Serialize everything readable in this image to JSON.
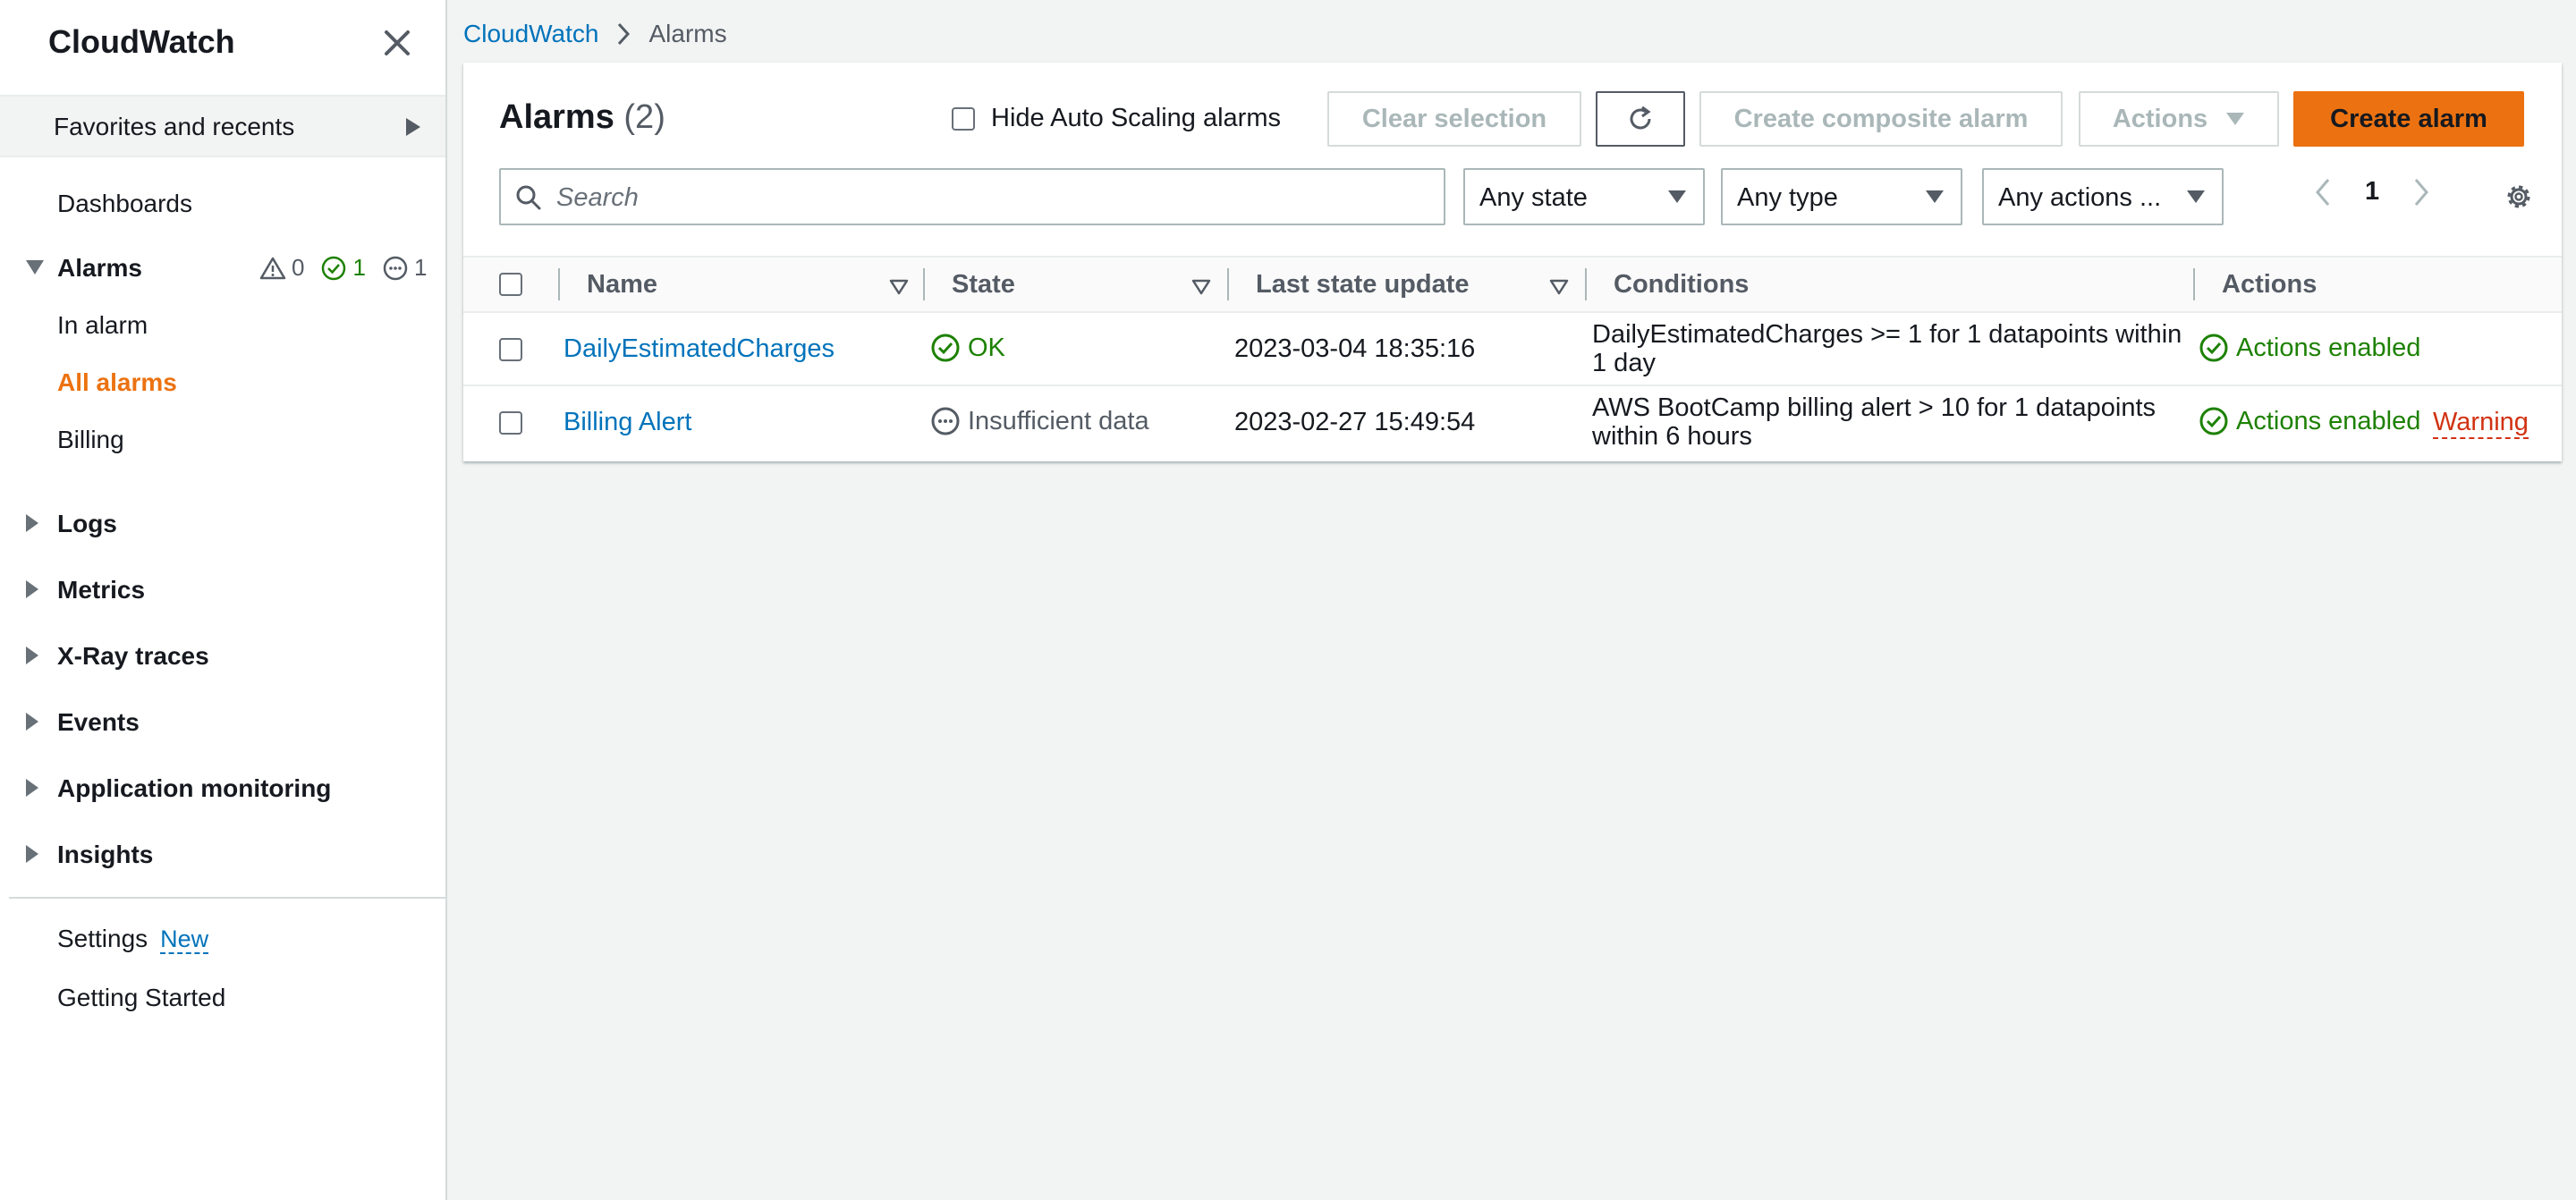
{
  "sidebar": {
    "title": "CloudWatch",
    "favorites": "Favorites and recents",
    "dashboards": "Dashboards",
    "alarms": "Alarms",
    "alarm_counts": {
      "alarm": "0",
      "ok": "1",
      "insufficient": "1"
    },
    "in_alarm": "In alarm",
    "all_alarms": "All alarms",
    "billing": "Billing",
    "logs": "Logs",
    "metrics": "Metrics",
    "xray": "X-Ray traces",
    "events": "Events",
    "app_monitoring": "Application monitoring",
    "insights": "Insights",
    "settings": "Settings",
    "settings_badge": "New",
    "getting_started": "Getting Started"
  },
  "breadcrumb": {
    "root": "CloudWatch",
    "current": "Alarms"
  },
  "panel": {
    "title": "Alarms",
    "count": "(2)",
    "hide_autoscaling": "Hide Auto Scaling alarms",
    "clear_selection": "Clear selection",
    "create_composite": "Create composite alarm",
    "actions": "Actions",
    "create_alarm": "Create alarm",
    "search_placeholder": "Search",
    "filter_state": "Any state",
    "filter_type": "Any type",
    "filter_actions": "Any actions ...",
    "page": "1"
  },
  "table": {
    "headers": {
      "name": "Name",
      "state": "State",
      "last_update": "Last state update",
      "conditions": "Conditions",
      "actions": "Actions"
    },
    "rows": [
      {
        "name": "DailyEstimatedCharges",
        "state": "OK",
        "last_update": "2023-03-04 18:35:16",
        "conditions_line1": "DailyEstimatedCharges >= 1 for 1 datapoints within",
        "conditions_line2": "1 day",
        "actions": "Actions enabled",
        "warning": ""
      },
      {
        "name": "Billing Alert",
        "state": "Insufficient data",
        "last_update": "2023-02-27 15:49:54",
        "conditions_line1": "AWS BootCamp billing alert > 10 for 1 datapoints",
        "conditions_line2": "within 6 hours",
        "actions": "Actions enabled",
        "warning": "Warning"
      }
    ]
  },
  "colors": {
    "accent": "#ec7211",
    "link": "#0073bb",
    "ok": "#1d8102",
    "warning": "#d13212"
  }
}
